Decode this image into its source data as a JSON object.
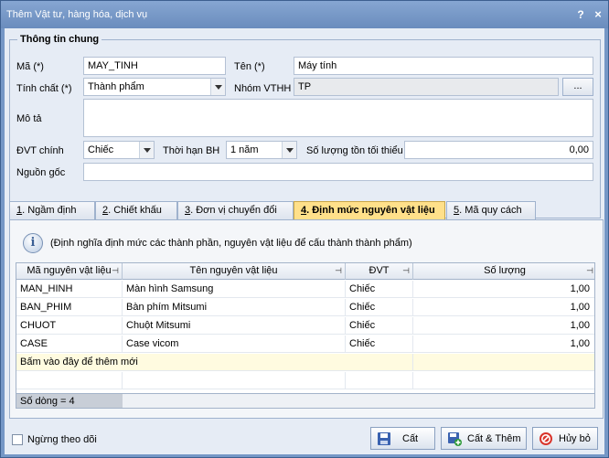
{
  "window": {
    "title": "Thêm Vật tư, hàng hóa, dịch vụ",
    "help": "?",
    "close": "×"
  },
  "general": {
    "group_title": "Thông tin chung",
    "ma_label": "Mã (*)",
    "ma_value": "MAY_TINH",
    "ten_label": "Tên (*)",
    "ten_value": "Máy tính",
    "tinhchat_label": "Tính chất (*)",
    "tinhchat_value": "Thành phẩm",
    "nhom_label": "Nhóm VTHH",
    "nhom_value": "TP",
    "nhom_button": "...",
    "mota_label": "Mô tả",
    "mota_value": "",
    "dvt_label": "ĐVT chính",
    "dvt_value": "Chiếc",
    "thoihan_label": "Thời hạn BH",
    "thoihan_value": "1 năm",
    "soluong_label": "Số lượng tồn tối thiểu",
    "soluong_value": "0,00",
    "nguongoc_label": "Nguồn gốc",
    "nguongoc_value": ""
  },
  "tabs": [
    {
      "num": "1",
      "label": ". Ngầm định"
    },
    {
      "num": "2",
      "label": ". Chiết khấu"
    },
    {
      "num": "3",
      "label": ". Đơn vị chuyển đổi"
    },
    {
      "num": "4",
      "label": ". Định mức nguyên vật liệu"
    },
    {
      "num": "5",
      "label": ". Mã quy cách"
    }
  ],
  "panel": {
    "info_icon": "i",
    "info": "(Định nghĩa định mức các thành phần, nguyên vật liệu để cấu thành thành phẩm)"
  },
  "grid": {
    "pin": "⊣",
    "columns": [
      "Mã nguyên vật liệu",
      "Tên nguyên vật liệu",
      "ĐVT",
      "Số lượng"
    ],
    "rows": [
      [
        "MAN_HINH",
        "Màn hình Samsung",
        "Chiếc",
        "1,00"
      ],
      [
        "BAN_PHIM",
        "Bàn phím Mitsumi",
        "Chiếc",
        "1,00"
      ],
      [
        "CHUOT",
        "Chuột Mitsumi",
        "Chiếc",
        "1,00"
      ],
      [
        "CASE",
        "Case vicom",
        "Chiếc",
        "1,00"
      ]
    ],
    "new_row": "Bấm vào đây để thêm mới",
    "footer": "Số dòng = 4"
  },
  "bottom": {
    "checkbox_label": "Ngừng theo dõi",
    "save": "Cất",
    "save_new": "Cất & Thêm",
    "cancel": "Hủy bỏ"
  },
  "colors": {
    "active_tab": "#ffe08a",
    "cancel_icon": "#d9342b",
    "save_icon": "#3a62b0",
    "save_new_icon": "#2f9a3a"
  }
}
